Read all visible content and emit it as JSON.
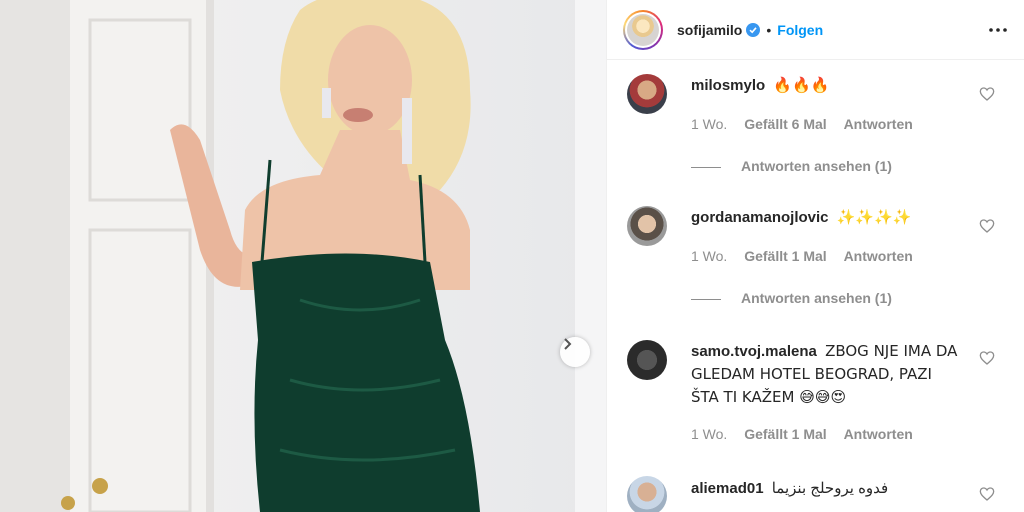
{
  "post": {
    "username": "sofijamilo",
    "follow_label": "Folgen",
    "separator": "•"
  },
  "icons": {
    "verified": "verified-badge-icon",
    "more": "more-options-icon",
    "next": "chevron-right-icon",
    "like": "heart-outline-icon"
  },
  "colors": {
    "accent": "#0095f6",
    "muted": "#8e8e8e",
    "dress": "#0f3d2e"
  },
  "comments": [
    {
      "user": "milosmylo",
      "text": "🔥🔥🔥",
      "age": "1 Wo.",
      "likes": "Gefällt 6 Mal",
      "reply": "Antworten",
      "view_replies": "Antworten ansehen (1)"
    },
    {
      "user": "gordanamanojlovic",
      "text": "✨✨✨✨",
      "age": "1 Wo.",
      "likes": "Gefällt 1 Mal",
      "reply": "Antworten",
      "view_replies": "Antworten ansehen (1)"
    },
    {
      "user": "samo.tvoj.malena",
      "text": "ZBOG NJE IMA DA GLEDAM HOTEL BEOGRAD, PAZI ŠTA TI KAŽEM 😅😅😍",
      "age": "1 Wo.",
      "likes": "Gefällt 1 Mal",
      "reply": "Antworten"
    },
    {
      "user": "aliemad01",
      "text": "فدوه يروحلج بنزيما"
    }
  ]
}
